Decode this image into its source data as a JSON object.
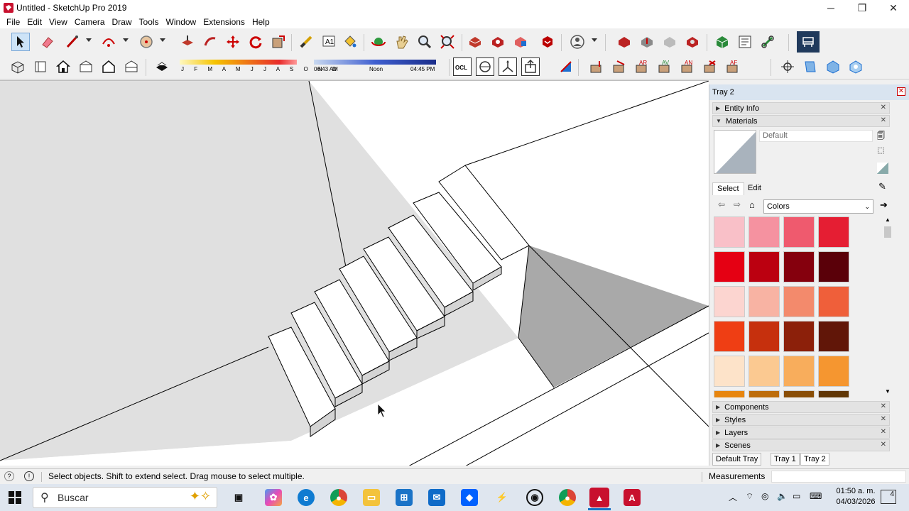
{
  "window": {
    "title": "Untitled - SketchUp Pro 2019",
    "minimize": "─",
    "restore": "❐",
    "close": "✕"
  },
  "menu": {
    "items": [
      "File",
      "Edit",
      "View",
      "Camera",
      "Draw",
      "Tools",
      "Window",
      "Extensions",
      "Help"
    ]
  },
  "shadow_settings": {
    "months": "J F M A M J J A S O N D",
    "time_start": "06:43 AM",
    "time_noon": "Noon",
    "time_end": "04:45 PM"
  },
  "tray": {
    "title": "Tray 2",
    "panels": {
      "entity_info": "Entity Info",
      "materials": "Materials",
      "components": "Components",
      "styles": "Styles",
      "layers": "Layers",
      "scenes": "Scenes"
    },
    "material_name": "Default",
    "tabs": {
      "select": "Select",
      "edit": "Edit"
    },
    "library": "Colors",
    "swatch_colors": [
      [
        "#f9c0c8",
        "#f592a0",
        "#ef5a6e",
        "#e51e33"
      ],
      [
        "#e50013",
        "#bb0010",
        "#85000d",
        "#5a0009"
      ],
      [
        "#fcd5d0",
        "#f8b3a3",
        "#f38a6c",
        "#ef5f3a"
      ],
      [
        "#ef3e14",
        "#c6300d",
        "#8c200a",
        "#611608"
      ],
      [
        "#fde3c9",
        "#fbc991",
        "#f8ad5c",
        "#f59630"
      ],
      [
        "#e7850e",
        "#bd6c0a",
        "#8a4e07",
        "#603605"
      ]
    ],
    "bottom_tabs": [
      "Default Tray",
      "Tray 1",
      "Tray 2"
    ]
  },
  "status": {
    "message": "Select objects. Shift to extend select. Drag mouse to select multiple.",
    "measurements_label": "Measurements"
  },
  "taskbar": {
    "search_placeholder": "Buscar",
    "time": "01:50 a. m.",
    "date": "04/03/2026",
    "notifications": "4"
  }
}
